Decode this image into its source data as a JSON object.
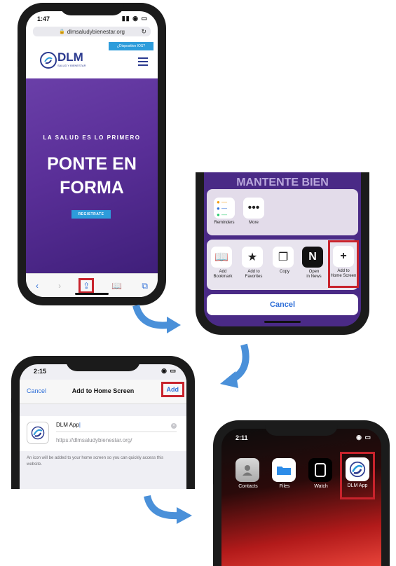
{
  "step1": {
    "time": "1:47",
    "url": "dlmsaludybienestar.org",
    "promo_button": "¿Dispositivo IOS?",
    "logo_text": "DLM",
    "logo_sub": "SALUD Y BIENESTAR",
    "tagline": "LA SALUD ES LO PRIMERO",
    "headline_1": "PONTE EN",
    "headline_2": "FORMA",
    "cta": "REGISTRATE",
    "icons": [
      "back-icon",
      "forward-icon",
      "share-icon",
      "bookmarks-icon",
      "tabs-icon"
    ]
  },
  "step2": {
    "background_text": "MANTENTE BIEN",
    "apps": [
      {
        "label": "Reminders"
      },
      {
        "label": "More"
      }
    ],
    "actions": [
      {
        "label_1": "Add",
        "label_2": "Bookmark"
      },
      {
        "label_1": "Add to",
        "label_2": "Favorites"
      },
      {
        "label_1": "Copy",
        "label_2": ""
      },
      {
        "label_1": "Open",
        "label_2": "in News"
      },
      {
        "label_1": "Add to",
        "label_2": "Home Screen"
      }
    ],
    "cancel": "Cancel"
  },
  "step3": {
    "time": "2:15",
    "cancel": "Cancel",
    "title": "Add to Home Screen",
    "add": "Add",
    "app_name": "DLM App",
    "url": "https://dlmsaludybienestar.org/",
    "description": "An icon will be added to your home screen so you can quickly access this website."
  },
  "step4": {
    "time": "2:11",
    "apps": [
      {
        "label": "Contacts"
      },
      {
        "label": "Files"
      },
      {
        "label": "Watch"
      },
      {
        "label": "DLM App"
      }
    ]
  },
  "colors": {
    "highlight": "#c8232c",
    "ios_blue": "#2f6fd8",
    "brand_purple": "#5a2f98",
    "arrow_blue": "#4a90d9"
  }
}
